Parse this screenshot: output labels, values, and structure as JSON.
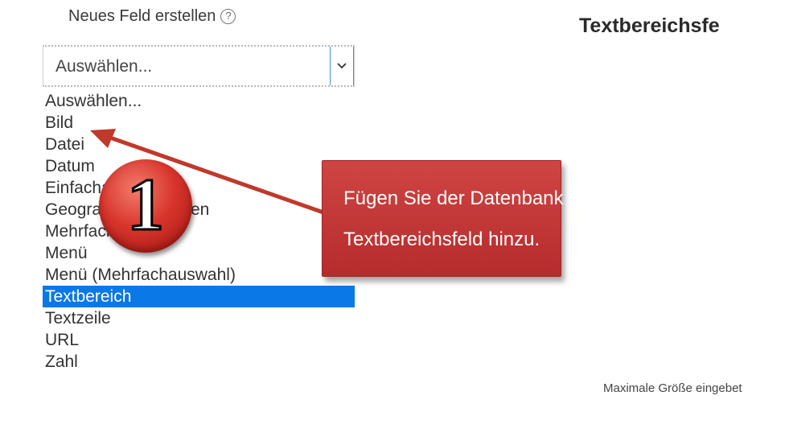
{
  "field": {
    "label": "Neues Feld erstellen",
    "help_icon_glyph": "?",
    "help_icon": "question-circle-icon"
  },
  "select": {
    "value": "Auswählen...",
    "arrow_icon": "chevron-down-icon"
  },
  "dropdown": {
    "options": [
      "Auswählen...",
      "Bild",
      "Datei",
      "Datum",
      "Einfachauswahl",
      "Geographische Daten",
      "Mehrfachauswahl",
      "Menü",
      "Menü (Mehrfachauswahl)",
      "Textbereich",
      "Textzeile",
      "URL",
      "Zahl"
    ],
    "selected": "Textbereich"
  },
  "right_panel": {
    "title": "Textbereichsfe",
    "footer": "Maximale Größe eingebet"
  },
  "annotation": {
    "badge_number": "1",
    "callout_line1": "Fügen Sie der Datenbank ein",
    "callout_line2": "Textbereichsfeld hinzu.",
    "accent_color": "#c0392b"
  }
}
